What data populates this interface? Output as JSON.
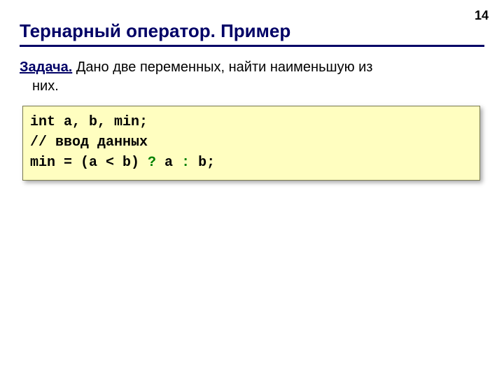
{
  "slide": {
    "number": "14",
    "title": "Тернарный оператор. Пример",
    "task": {
      "label": "Задача.",
      "line1": " Дано две переменных, найти наименьшую из",
      "line2": "них."
    },
    "code": {
      "line1": "int a, b, min;",
      "line2": "// ввод данных",
      "line3": {
        "p1": "min = (a < b) ",
        "q": "?",
        "p2": " a ",
        "c": ":",
        "p3": " b;"
      }
    }
  }
}
